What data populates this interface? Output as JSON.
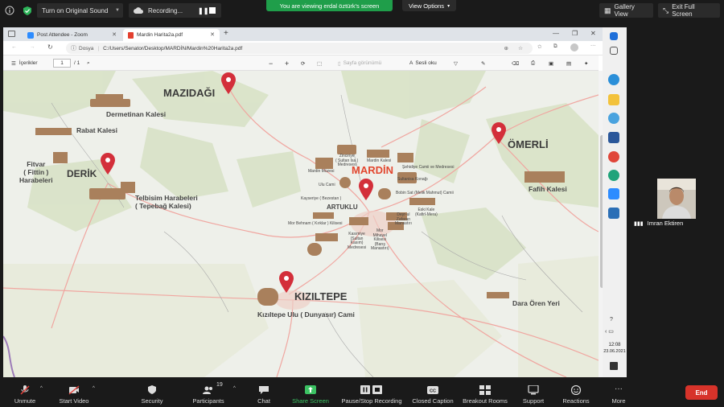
{
  "zoom_top": {
    "sound_label": "Turn on Original Sound",
    "recording_label": "Recording...",
    "banner": "You are viewing erdal öztürk's screen",
    "view_options": "View Options",
    "gallery_view": "Gallery View",
    "exit_fullscreen": "Exit Full Screen"
  },
  "browser": {
    "tabs": [
      {
        "label": "Post Attendee - Zoom"
      },
      {
        "label": "Mardin Harita2a.pdf"
      }
    ],
    "address_prefix": "Dosya",
    "address": "C:/Users/Senator/Desktop/MARDİN/Mardin%20Harita2a.pdf"
  },
  "pdf_toolbar": {
    "contents": "İçerikler",
    "page": "1",
    "page_total": "/ 1",
    "page_view": "Sayfa görünümü",
    "read_aloud": "Sesli oku"
  },
  "map": {
    "labels": {
      "mazidagi": "MAZIDAĞI",
      "dermetinan": "Dermetinan Kalesi",
      "rabat": "Rabat Kalesi",
      "fitvar": "Fitvar\n( Fittin )\nHarabeleri",
      "derik": "DERİK",
      "telbisim": "Telbisim Harabeleri\n( Tepebağ Kalesi)",
      "mardin": "MARDİN",
      "artuklu": "ARTUKLU",
      "omerli": "ÖMERLİ",
      "fafih": "Fafih Kalesi",
      "kiziltepe": "KIZILTEPE",
      "kiziltepe_cami": "Kızıltepe Ulu ( Dunyasır) Cami",
      "dara": "Dara Ören Yeri",
      "zinciriye": "Zinciriye\n( Sultan İsa )\nMedresesi",
      "mardin_kalesi": "Mardin Kalesi",
      "sehidiye": "Şehidiye Camii ve Medresesi",
      "mardin_muzesi": "Mardin Müzesi",
      "sultanisa": "Sultanisa Konağı",
      "ulu_cami": "Ulu Cami",
      "bobin": "Bobin Sat (Melik Mahmut) Camii",
      "kayseriye": "Kayseriye ( Bezestan )",
      "eski_kale": "Eski Kale\n(Kafirl-Mera)",
      "mor_behnam": "Mor Behnam ( Kırklar ) Kilisesi",
      "deyr": "Deyr-ul\nZafaran\nManastırı",
      "kasimiye": "Kasımiye\n(Sultan\nKasım)\nMedresesi",
      "mor_mihayel": "Mor\nMihayel\nKilisesi\n(Barış\nManastırı)"
    }
  },
  "windows_tray": {
    "time": "12:08",
    "date": "23.06.2021"
  },
  "participant": {
    "name": "Imran Ektiren"
  },
  "zoom_bottom": {
    "unmute": "Unmute",
    "start_video": "Start Video",
    "security": "Security",
    "participants": "Participants",
    "participants_count": "19",
    "chat": "Chat",
    "share_screen": "Share Screen",
    "pause_recording": "Pause/Stop Recording",
    "closed_caption": "Closed Caption",
    "breakout": "Breakout Rooms",
    "support": "Support",
    "reactions": "Reactions",
    "more": "More",
    "end": "End"
  },
  "colors": {
    "zoom_bg": "#1a1a1a",
    "banner_green": "#1f9e4a",
    "pin_red": "#d32f3a",
    "share_green": "#3cc263",
    "end_red": "#d7332a"
  }
}
